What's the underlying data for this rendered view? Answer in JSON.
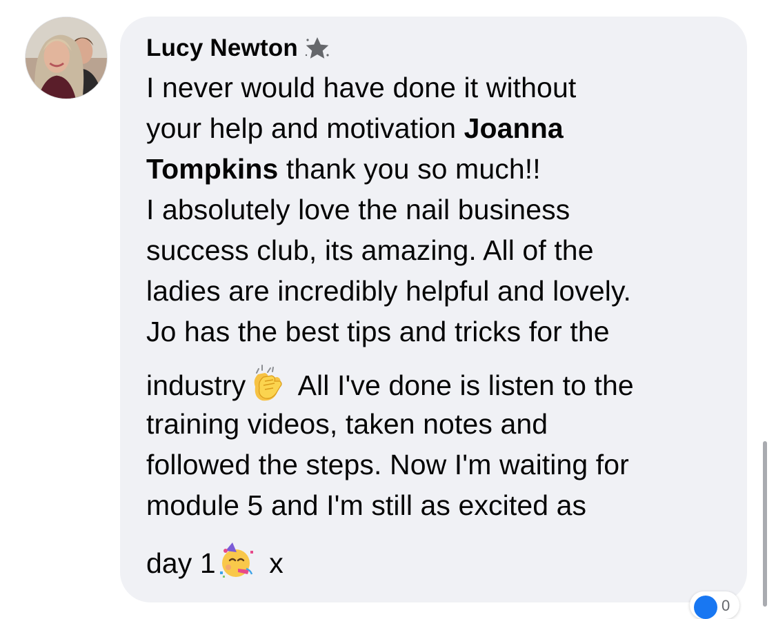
{
  "comment": {
    "author": "Lucy Newton",
    "author_badge_icon": "star-badge-icon",
    "lines": {
      "l1": "I never would have done it without",
      "l2": "your help and motivation ",
      "l2_mention": "Joanna",
      "l3_mention": "Tompkins",
      "l3": " thank you so much!!",
      "l4": "I absolutely love the nail business",
      "l5": "success club, its amazing. All of the",
      "l6": "ladies are incredibly helpful and lovely.",
      "l7": "Jo has the best tips and tricks for the",
      "l8a": "industry",
      "l8b": " All I've done is listen to the",
      "l9": "training videos, taken notes and",
      "l10": "followed the steps. Now I'm waiting for",
      "l11": "module 5 and I'm still as excited as",
      "l12a": "day 1",
      "l12b": " x"
    },
    "emojis": [
      "clapping-hands-emoji",
      "partying-face-emoji"
    ],
    "reaction": {
      "icon": "like-reaction-icon",
      "count": "0"
    }
  },
  "colors": {
    "bubble_bg": "#f0f1f5",
    "text": "#050505",
    "like_blue": "#1877f2"
  }
}
